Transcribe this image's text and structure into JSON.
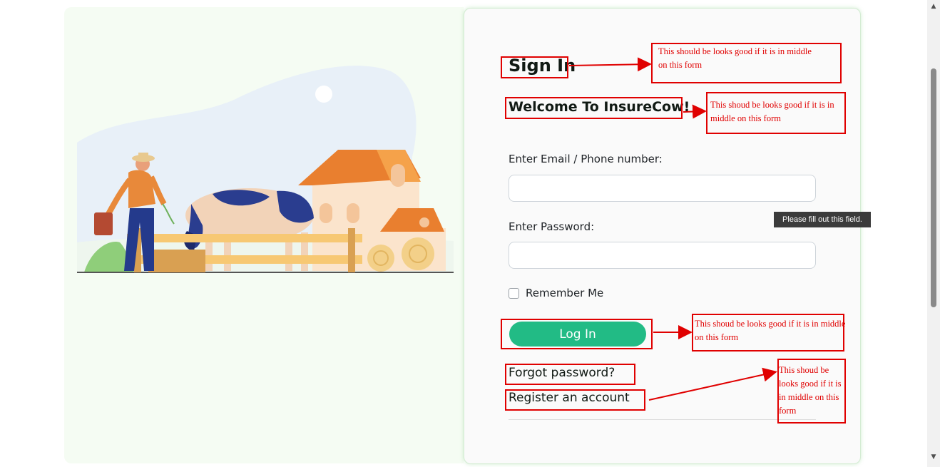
{
  "form": {
    "title": "Sign In",
    "subtitle": "Welcome To InsureCow!",
    "email_label": "Enter Email / Phone number:",
    "email_value": "",
    "password_label": "Enter Password:",
    "password_value": "",
    "remember_label": "Remember Me",
    "login_label": "Log In",
    "forgot_link": "Forgot password?",
    "register_link": "Register an account"
  },
  "tooltip": "Please fill out this field.",
  "annotations": [
    "This should be looks good if it is in middle on this form",
    "This shoud be looks good if it is in middle on this form",
    "This shoud be looks good if it is in middle on this form",
    "This shoud be looks good if it is in middle on this form"
  ],
  "colors": {
    "accent": "#22bb85",
    "annotation": "#e00000",
    "panel_bg": "#f5fcf3"
  },
  "icons": {
    "scroll_up": "▲",
    "scroll_down": "▼"
  }
}
